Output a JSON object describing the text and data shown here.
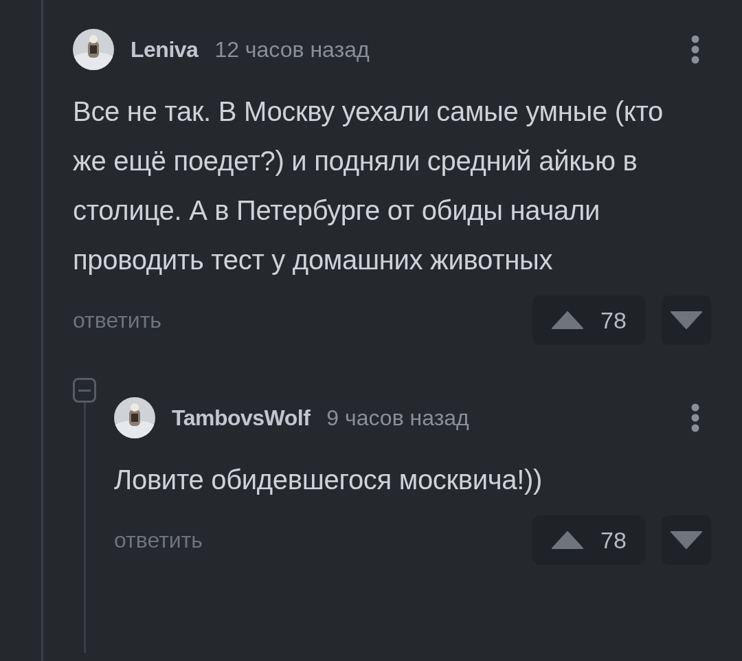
{
  "comments": [
    {
      "author": "Leniva",
      "time": "12 часов назад",
      "text": "Все не так. В Москву уехали самые умные (кто же ещё поедет?) и подняли средний айкью в столице. А в Петербурге от обиды начали проводить тест у домашних животных",
      "reply_label": "ответить",
      "votes": "78",
      "expanded": true,
      "children": [
        {
          "author": "TambovsWolf",
          "time": "9 часов назад",
          "text": "Ловите обидевшегося москвича!))",
          "reply_label": "ответить",
          "votes": "78"
        }
      ]
    }
  ]
}
